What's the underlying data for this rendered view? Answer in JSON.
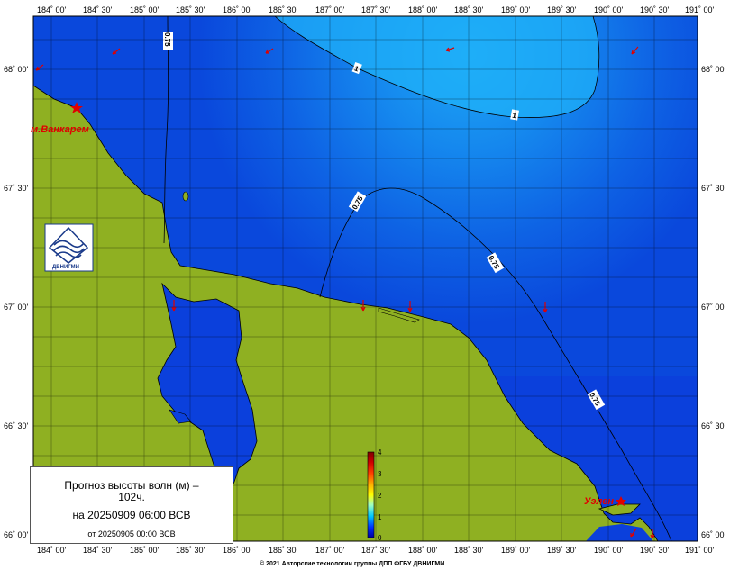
{
  "map": {
    "lon_labels": [
      "184˚ 00'",
      "184˚ 30'",
      "185˚ 00'",
      "185˚ 30'",
      "186˚ 00'",
      "186˚ 30'",
      "187˚ 00'",
      "187˚ 30'",
      "188˚ 00'",
      "188˚ 30'",
      "189˚ 00'",
      "189˚ 30'",
      "190˚ 00'",
      "190˚ 30'",
      "191˚ 00'"
    ],
    "lat_labels": [
      "68˚ 00'",
      "67˚ 30'",
      "67˚ 00'",
      "66˚ 30'",
      "66˚ 00'"
    ],
    "places": {
      "vankarem": "м.Ванкарем",
      "uelen": "Уэлен"
    },
    "isolines": {
      "i1": "0.75",
      "i2": "1",
      "i3": "1",
      "i4": "0.75",
      "i5": "0.75",
      "i6": "0.75"
    },
    "colors": {
      "land": "#8fb022",
      "sea_low": "#0a3bde",
      "sea_high": "#1aa0f4"
    }
  },
  "colorbar": {
    "labels": [
      "4",
      "3",
      "2",
      "1",
      "0"
    ]
  },
  "info": {
    "title": "Прогноз высоты волн (м) –",
    "hours": "102ч.",
    "valid": "на 20250909 06:00 ВСВ",
    "from": "от 20250905 00:00 ВСВ"
  },
  "logo": {
    "text": "ДВНИГМИ"
  },
  "copyright": "© 2021 Авторские технологии группы ДПП ФГБУ ДВНИГМИ"
}
